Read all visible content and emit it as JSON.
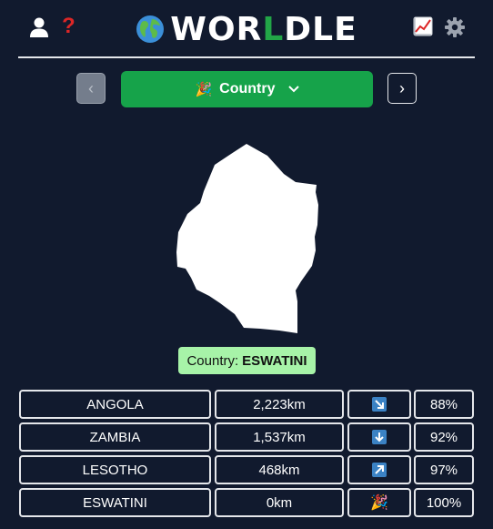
{
  "header": {
    "title_pre": "WOR",
    "title_accent": "L",
    "title_post": "DLE",
    "icons": [
      "user-icon",
      "help-icon",
      "stats-icon",
      "settings-icon"
    ],
    "help_symbol": "?"
  },
  "nav": {
    "prev_symbol": "‹",
    "next_symbol": "›",
    "mode_label": "Country",
    "mode_icon": "🎉"
  },
  "answer": {
    "label": "Country:",
    "value": "ESWATINI"
  },
  "guesses": [
    {
      "country": "ANGOLA",
      "distance": "2,223km",
      "direction": "southeast-arrow",
      "proximity": "88%"
    },
    {
      "country": "ZAMBIA",
      "distance": "1,537km",
      "direction": "south-arrow",
      "proximity": "92%"
    },
    {
      "country": "LESOTHO",
      "distance": "468km",
      "direction": "northeast-arrow",
      "proximity": "97%"
    },
    {
      "country": "ESWATINI",
      "distance": "0km",
      "direction": "party-icon",
      "direction_symbol": "🎉",
      "proximity": "100%"
    }
  ],
  "colors": {
    "background": "#111a2e",
    "accent": "#16a34a",
    "answer_bg": "#a7f3a8",
    "arrow_bg": "#3b82c4",
    "help": "#dc2626"
  }
}
